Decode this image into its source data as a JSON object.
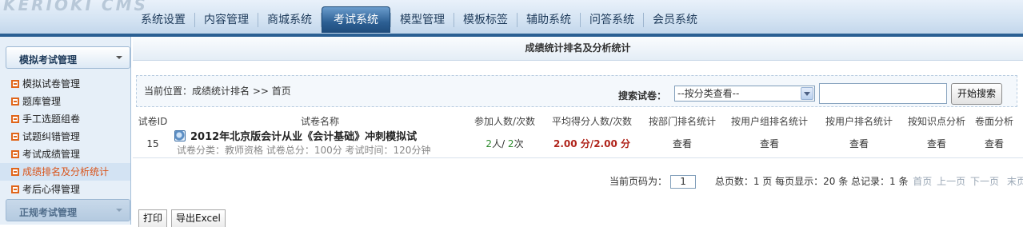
{
  "logo_text": "KERIOKI CMS",
  "nav": {
    "items": [
      "系统设置",
      "内容管理",
      "商城系统",
      "考试系统",
      "模型管理",
      "模板标签",
      "辅助系统",
      "问答系统",
      "会员系统"
    ],
    "active": "考试系统"
  },
  "sidebar": {
    "section_open": "模拟考试管理",
    "items": [
      "模拟试卷管理",
      "题库管理",
      "手工选题组卷",
      "试题纠错管理",
      "考试成绩管理",
      "成绩排名及分析统计",
      "考后心得管理"
    ],
    "active_item": "成绩排名及分析统计",
    "section_collapsed": "正规考试管理"
  },
  "page_title": "成绩统计排名及分析统计",
  "search": {
    "breadcrumb": "当前位置：成绩统计排名 >> 首页",
    "label": "搜索试卷：",
    "select_value": "--按分类查看--",
    "input_value": "",
    "button": "开始搜索"
  },
  "table": {
    "headers": [
      "试卷ID",
      "试卷名称",
      "参加人数/次数",
      "平均得分人数/次数",
      "按部门排名统计",
      "按用户组排名统计",
      "按用户排名统计",
      "按知识点分析",
      "卷面分析"
    ],
    "rows": [
      {
        "id": "15",
        "title": "2012年北京版会计从业《会计基础》冲刺模拟试",
        "meta": "试卷分类：教师资格 试卷总分：100分 考试时间：120分钟",
        "participants": "2",
        "participants_unit": "人/ ",
        "times": "2",
        "times_unit": "次",
        "avg_a": "2.00",
        "avg_sep": " 分/",
        "avg_b": "2.00",
        "avg_unit": " 分",
        "link": "查看"
      }
    ]
  },
  "pager": {
    "current_label": "当前页码为：",
    "current_page": "1",
    "summary": "总页数：1 页 每页显示：20 条 总记录：1 条",
    "first": "首页",
    "prev": "上一页",
    "next": "下一页",
    "last": "末页"
  },
  "actions": {
    "print": "打印",
    "export": "导出Excel"
  },
  "colors": {
    "nav_active": "#2c5f93",
    "sidebar_active_text": "#d9541a",
    "score_red": "#b0241b",
    "count_green": "#2e8b2e"
  }
}
